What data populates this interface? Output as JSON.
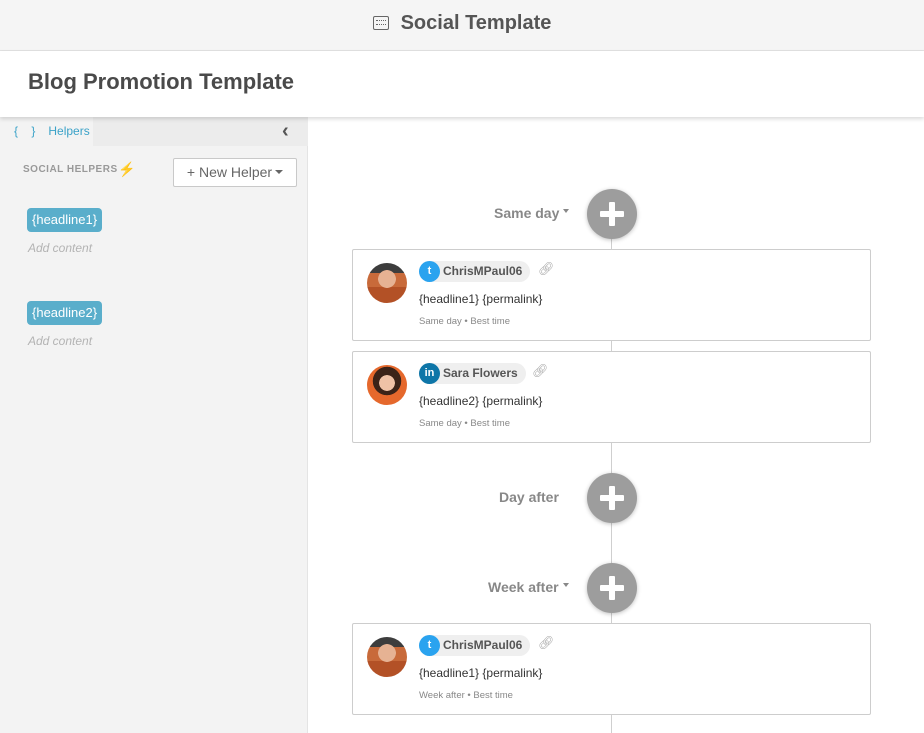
{
  "window": {
    "title": "Social Template",
    "icon": "template-icon"
  },
  "page": {
    "title": "Blog Promotion Template"
  },
  "sidebar": {
    "tab_label": "Helpers",
    "tab_icon": "{ }",
    "collapse_glyph": "‹",
    "section_label": "SOCIAL HELPERS",
    "new_helper_label": "+ New Helper",
    "helpers": [
      {
        "tag": "{headline1}",
        "placeholder": "Add content"
      },
      {
        "tag": "{headline2}",
        "placeholder": "Add content"
      }
    ]
  },
  "timeline": {
    "groups": [
      {
        "label": "Same day",
        "has_menu": true
      },
      {
        "label": "Day after",
        "has_menu": false
      },
      {
        "label": "Week after",
        "has_menu": true
      }
    ],
    "posts": [
      {
        "network": "twitter",
        "account": "ChrisMPaul06",
        "text": "{headline1} {permalink}",
        "meta": "Same day • Best time"
      },
      {
        "network": "linkedin",
        "account": "Sara Flowers",
        "text": "{headline2} {permalink}",
        "meta": "Same day • Best time"
      },
      {
        "network": "twitter",
        "account": "ChrisMPaul06",
        "text": "{headline1} {permalink}",
        "meta": "Week after • Best time"
      }
    ]
  },
  "colors": {
    "accent": "#3aa2c8",
    "helper_tag": "#5aaecb",
    "twitter": "#2aa3ef",
    "linkedin": "#0e76a8",
    "add_button": "#9d9d9d"
  }
}
